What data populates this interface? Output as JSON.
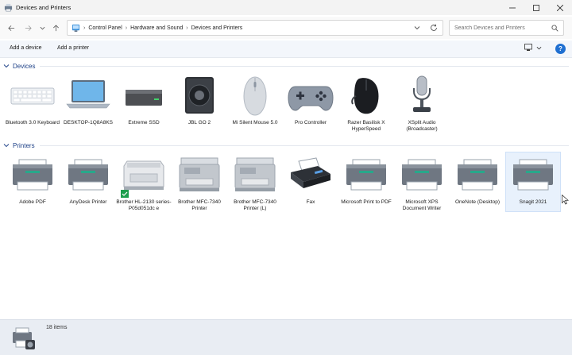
{
  "window": {
    "title": "Devices and Printers"
  },
  "address": {
    "crumbs": [
      "Control Panel",
      "Hardware and Sound",
      "Devices and Printers"
    ]
  },
  "search": {
    "placeholder": "Search Devices and Printers"
  },
  "commands": {
    "add_device": "Add a device",
    "add_printer": "Add a printer"
  },
  "sections": {
    "devices": "Devices",
    "printers": "Printers"
  },
  "devices": [
    {
      "label": "Bluetooth 3.0 Keyboard",
      "icon": "keyboard-icon"
    },
    {
      "label": "DESKTOP-1Q8A8KS",
      "icon": "laptop-icon"
    },
    {
      "label": "Extreme SSD",
      "icon": "external-drive-icon"
    },
    {
      "label": "JBL GO 2",
      "icon": "speaker-icon"
    },
    {
      "label": "Mi Silent Mouse 5.0",
      "icon": "mouse-icon"
    },
    {
      "label": "Pro Controller",
      "icon": "gamepad-icon"
    },
    {
      "label": "Razer Basilisk X HyperSpeed",
      "icon": "gaming-mouse-icon"
    },
    {
      "label": "XSplit Audio (Broadcaster)",
      "icon": "microphone-icon"
    }
  ],
  "printers": [
    {
      "label": "Adobe PDF",
      "icon": "printer-icon"
    },
    {
      "label": "AnyDesk Printer",
      "icon": "printer-icon"
    },
    {
      "label": "Brother HL-2130 series-P05d051dc e",
      "icon": "laser-printer-icon"
    },
    {
      "label": "Brother MFC-7340 Printer",
      "icon": "mfc-printer-icon"
    },
    {
      "label": "Brother MFC-7340 Printer (L)",
      "icon": "mfc-printer-icon"
    },
    {
      "label": "Fax",
      "icon": "fax-icon"
    },
    {
      "label": "Microsoft Print to PDF",
      "icon": "printer-icon"
    },
    {
      "label": "Microsoft XPS Document Writer",
      "icon": "printer-icon"
    },
    {
      "label": "OneNote (Desktop)",
      "icon": "printer-icon"
    },
    {
      "label": "Snagit 2021",
      "icon": "printer-icon",
      "selected": true
    }
  ],
  "status": {
    "item_count": "18 items"
  },
  "colors": {
    "accent": "#1f6fd1",
    "section_label": "#1c3f86",
    "printer_accent": "#27a88a"
  }
}
